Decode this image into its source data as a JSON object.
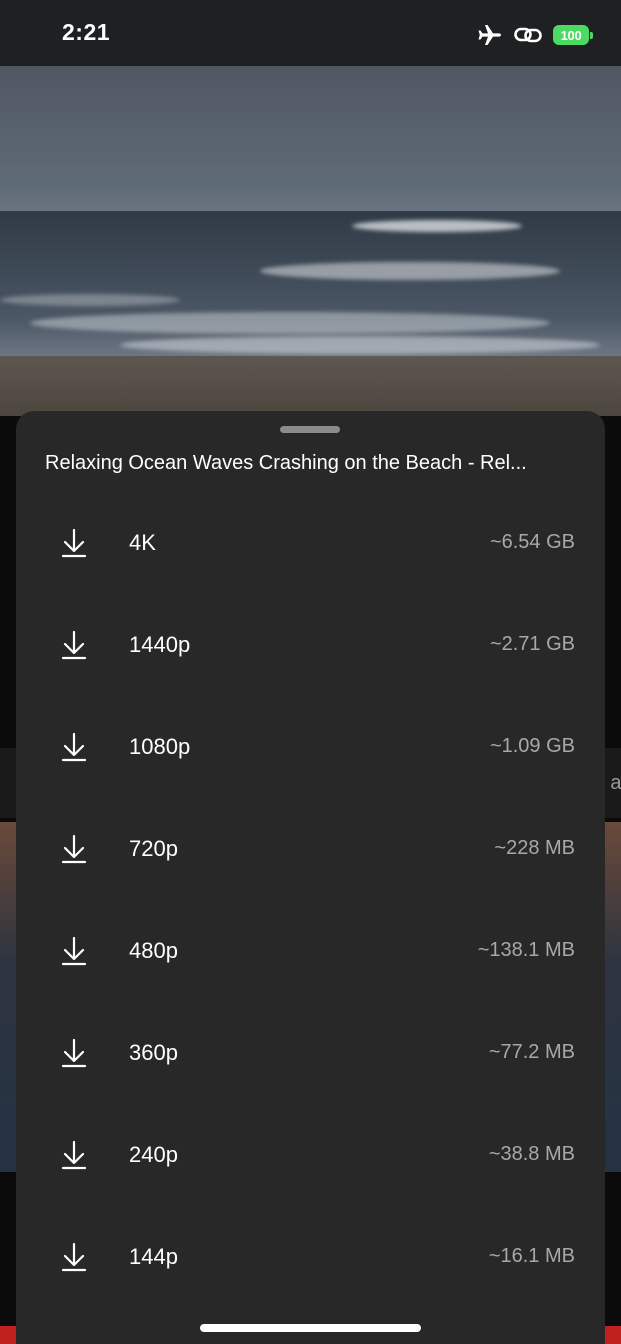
{
  "status_bar": {
    "time": "2:21",
    "battery_level": "100",
    "battery_color": "#4cd964",
    "icons": [
      "airplane-mode-icon",
      "link-icon",
      "battery-charging-icon"
    ]
  },
  "video": {
    "scene": "ocean-waves-beach"
  },
  "background_peek": {
    "right_text": "at"
  },
  "sheet": {
    "title": "Relaxing Ocean Waves Crashing on the Beach - Rel...",
    "options": [
      {
        "label": "4K",
        "size": "~6.54 GB",
        "icon": "download-icon"
      },
      {
        "label": "1440p",
        "size": "~2.71 GB",
        "icon": "download-icon"
      },
      {
        "label": "1080p",
        "size": "~1.09 GB",
        "icon": "download-icon"
      },
      {
        "label": "720p",
        "size": "~228 MB",
        "icon": "download-icon"
      },
      {
        "label": "480p",
        "size": "~138.1 MB",
        "icon": "download-icon"
      },
      {
        "label": "360p",
        "size": "~77.2 MB",
        "icon": "download-icon"
      },
      {
        "label": "240p",
        "size": "~38.8 MB",
        "icon": "download-icon"
      },
      {
        "label": "144p",
        "size": "~16.1 MB",
        "icon": "download-icon"
      }
    ]
  }
}
